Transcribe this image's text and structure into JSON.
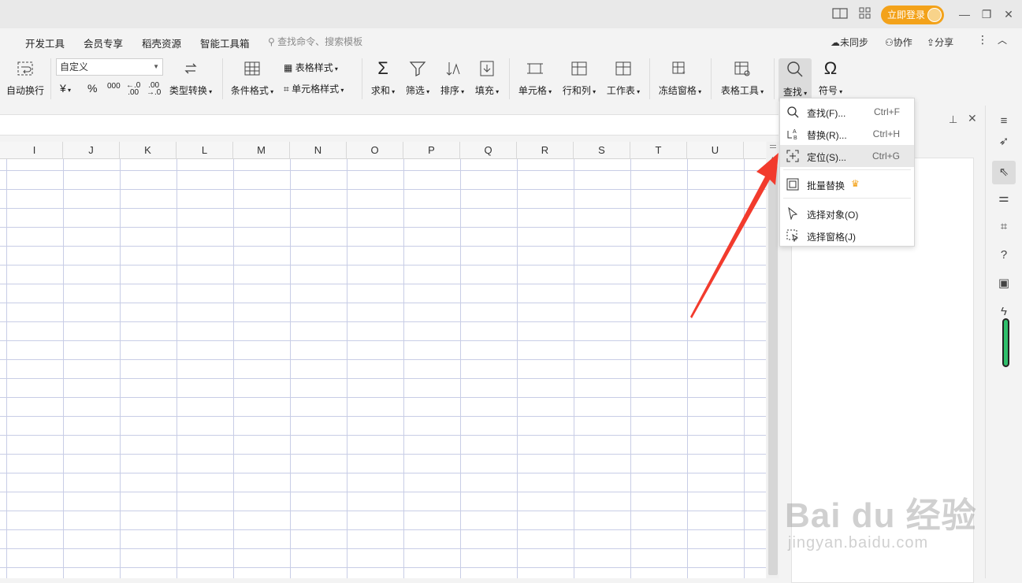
{
  "titlebar": {
    "login_label": "立即登录"
  },
  "menu": {
    "items": [
      "开发工具",
      "会员专享",
      "稻壳资源",
      "智能工具箱"
    ],
    "search_placeholder": "查找命令、搜索模板",
    "sync_label": "未同步",
    "collab_label": "协作",
    "share_label": "分享"
  },
  "ribbon": {
    "autowrap": "自动换行",
    "format_value": "自定义",
    "currency": "¥",
    "percent": "%",
    "thousands": "000",
    "type_convert": "类型转换",
    "cond_format": "条件格式",
    "table_style": "表格样式",
    "cell_style": "单元格样式",
    "sum": "求和",
    "filter": "筛选",
    "sort": "排序",
    "fill": "填充",
    "cell": "单元格",
    "row_col": "行和列",
    "worksheet": "工作表",
    "freeze": "冻结窗格",
    "table_tools": "表格工具",
    "find": "查找",
    "symbol": "符号"
  },
  "grid": {
    "columns": [
      "I",
      "J",
      "K",
      "L",
      "M",
      "N",
      "O",
      "P",
      "Q",
      "R",
      "S",
      "T",
      "U"
    ]
  },
  "dropdown": {
    "items": [
      {
        "label": "查找(F)...",
        "shortcut": "Ctrl+F"
      },
      {
        "label": "替换(R)...",
        "shortcut": "Ctrl+H"
      },
      {
        "label": "定位(S)...",
        "shortcut": "Ctrl+G"
      },
      {
        "label": "批量替换",
        "shortcut": ""
      },
      {
        "label": "选择对象(O)",
        "shortcut": ""
      },
      {
        "label": "选择窗格(J)",
        "shortcut": ""
      }
    ]
  },
  "watermark": {
    "brand": "Bai du 经验",
    "url": "jingyan.baidu.com"
  },
  "colors": {
    "accent": "#f3a21a",
    "arrow": "#f23b2d",
    "gridline": "#c8cde6"
  }
}
